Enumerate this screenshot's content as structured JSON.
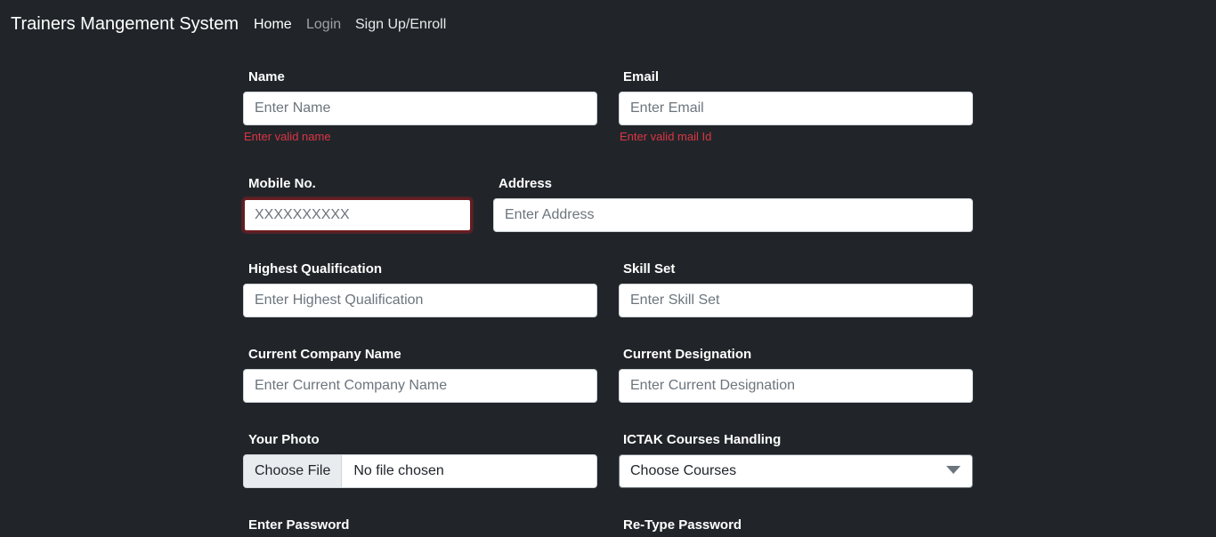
{
  "navbar": {
    "brand": "Trainers Mangement System",
    "links": [
      "Home",
      "Login",
      "Sign Up/Enroll"
    ]
  },
  "form": {
    "name": {
      "label": "Name",
      "placeholder": "Enter Name",
      "error": "Enter valid name"
    },
    "email": {
      "label": "Email",
      "placeholder": "Enter Email",
      "error": "Enter valid mail Id"
    },
    "mobile": {
      "label": "Mobile No.",
      "placeholder": "XXXXXXXXXX"
    },
    "address": {
      "label": "Address",
      "placeholder": "Enter Address"
    },
    "qualification": {
      "label": "Highest Qualification",
      "placeholder": "Enter Highest Qualification"
    },
    "skills": {
      "label": "Skill Set",
      "placeholder": "Enter Skill Set"
    },
    "company": {
      "label": "Current Company Name",
      "placeholder": "Enter Current Company Name"
    },
    "designation": {
      "label": "Current Designation",
      "placeholder": "Enter Current Designation"
    },
    "photo": {
      "label": "Your Photo",
      "button": "Choose File",
      "status": "No file chosen"
    },
    "courses": {
      "label": "ICTAK Courses Handling",
      "selected": "Choose Courses"
    },
    "password": {
      "label": "Enter Password"
    },
    "retype_password": {
      "label": "Re-Type Password"
    }
  }
}
